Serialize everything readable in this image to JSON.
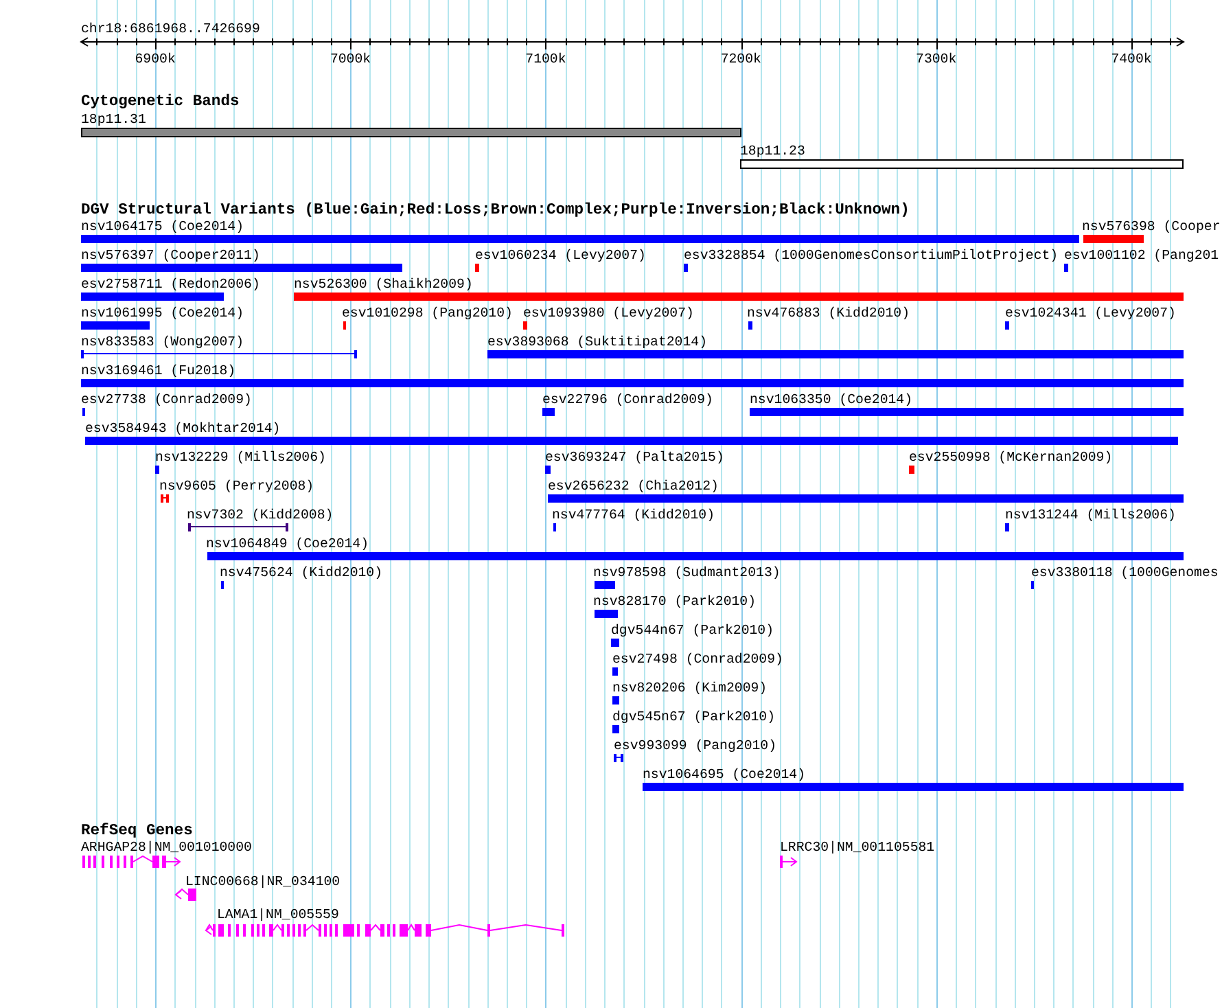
{
  "ruler": {
    "position": "chr18:6861968..7426699",
    "ticks": [
      "6900k",
      "7000k",
      "7100k",
      "7200k",
      "7300k",
      "7400k"
    ]
  },
  "tracks": [
    {
      "kind": "bands",
      "title": "Cytogenetic Bands",
      "bands": [
        {
          "label": "18p11.31",
          "color": "#888888"
        },
        {
          "label": "18p11.23",
          "color": "#ffffff"
        }
      ]
    },
    {
      "kind": "variants",
      "title": "DGV Structural Variants (Blue:Gain;Red:Loss;Brown:Complex;Purple:Inversion;Black:Unknown)",
      "rows": [
        {
          "items": [
            {
              "label": "nsv1064175 (Coe2014)",
              "kind": "bar",
              "color": "#0000ff"
            },
            {
              "label": "nsv576398 (Cooper",
              "kind": "bar",
              "color": "#ff0000"
            }
          ]
        },
        {
          "items": [
            {
              "label": "nsv576397 (Cooper2011)",
              "kind": "bar",
              "color": "#0000ff"
            },
            {
              "label": "esv1060234 (Levy2007)",
              "kind": "bar",
              "color": "#ff0000"
            },
            {
              "label": "esv3328854 (1000GenomesConsortiumPilotProject)",
              "kind": "bar",
              "color": "#0000ff"
            },
            {
              "label": "esv1001102 (Pang201",
              "kind": "bar",
              "color": "#0000ff"
            }
          ]
        },
        {
          "items": [
            {
              "label": "esv2758711 (Redon2006)",
              "kind": "bar",
              "color": "#0000ff"
            },
            {
              "label": "nsv526300 (Shaikh2009)",
              "kind": "bar",
              "color": "#ff0000"
            }
          ]
        },
        {
          "items": [
            {
              "label": "nsv1061995 (Coe2014)",
              "kind": "bar",
              "color": "#0000ff"
            },
            {
              "label": "esv1010298 (Pang2010)",
              "kind": "bar",
              "color": "#ff0000"
            },
            {
              "label": "esv1093980 (Levy2007)",
              "kind": "bar",
              "color": "#ff0000"
            },
            {
              "label": "nsv476883 (Kidd2010)",
              "kind": "bar",
              "color": "#0000ff"
            },
            {
              "label": "esv1024341 (Levy2007)",
              "kind": "bar",
              "color": "#0000ff"
            }
          ]
        },
        {
          "items": [
            {
              "label": "nsv833583 (Wong2007)",
              "kind": "span",
              "color": "#0000ff"
            },
            {
              "label": "esv3893068 (Suktitipat2014)",
              "kind": "bar",
              "color": "#0000ff"
            }
          ]
        },
        {
          "items": [
            {
              "label": "nsv3169461 (Fu2018)",
              "kind": "bar",
              "color": "#0000ff"
            }
          ]
        },
        {
          "items": [
            {
              "label": "esv27738 (Conrad2009)",
              "kind": "bar",
              "color": "#0000ff"
            },
            {
              "label": "esv22796 (Conrad2009)",
              "kind": "bar",
              "color": "#0000ff"
            },
            {
              "label": "nsv1063350 (Coe2014)",
              "kind": "bar",
              "color": "#0000ff"
            }
          ]
        },
        {
          "items": [
            {
              "label": "esv3584943 (Mokhtar2014)",
              "kind": "bar",
              "color": "#0000ff"
            }
          ]
        },
        {
          "items": [
            {
              "label": "nsv132229 (Mills2006)",
              "kind": "bar",
              "color": "#0000ff"
            },
            {
              "label": "esv3693247 (Palta2015)",
              "kind": "bar",
              "color": "#0000ff"
            },
            {
              "label": "esv2550998 (McKernan2009)",
              "kind": "bar",
              "color": "#ff0000"
            }
          ]
        },
        {
          "items": [
            {
              "label": "nsv9605 (Perry2008)",
              "kind": "span",
              "color": "#ff0000"
            },
            {
              "label": "esv2656232 (Chia2012)",
              "kind": "bar",
              "color": "#0000ff"
            }
          ]
        },
        {
          "items": [
            {
              "label": "nsv7302 (Kidd2008)",
              "kind": "span",
              "color": "#400080"
            },
            {
              "label": "nsv477764 (Kidd2010)",
              "kind": "bar",
              "color": "#0000ff"
            },
            {
              "label": "nsv131244 (Mills2006)",
              "kind": "bar",
              "color": "#0000ff"
            }
          ]
        },
        {
          "items": [
            {
              "label": "nsv1064849 (Coe2014)",
              "kind": "bar",
              "color": "#0000ff"
            }
          ]
        },
        {
          "items": [
            {
              "label": "nsv475624 (Kidd2010)",
              "kind": "bar",
              "color": "#0000ff"
            },
            {
              "label": "nsv978598 (Sudmant2013)",
              "kind": "bar",
              "color": "#0000ff"
            },
            {
              "label": "esv3380118 (1000Genomes",
              "kind": "bar",
              "color": "#0000ff"
            }
          ]
        },
        {
          "items": [
            {
              "label": "nsv828170 (Park2010)",
              "kind": "bar",
              "color": "#0000ff"
            }
          ]
        },
        {
          "items": [
            {
              "label": "dgv544n67 (Park2010)",
              "kind": "bar",
              "color": "#0000ff"
            }
          ]
        },
        {
          "items": [
            {
              "label": "esv27498 (Conrad2009)",
              "kind": "bar",
              "color": "#0000ff"
            }
          ]
        },
        {
          "items": [
            {
              "label": "nsv820206 (Kim2009)",
              "kind": "bar",
              "color": "#0000ff"
            }
          ]
        },
        {
          "items": [
            {
              "label": "dgv545n67 (Park2010)",
              "kind": "bar",
              "color": "#0000ff"
            }
          ]
        },
        {
          "items": [
            {
              "label": "esv993099 (Pang2010)",
              "kind": "span",
              "color": "#0000ff"
            }
          ]
        },
        {
          "items": [
            {
              "label": "nsv1064695 (Coe2014)",
              "kind": "bar",
              "color": "#0000ff"
            }
          ]
        }
      ]
    },
    {
      "kind": "genes",
      "title": "RefSeq Genes",
      "genes": [
        {
          "label": "ARHGAP28|NM_001010000",
          "reverse": false
        },
        {
          "label": "LRRC30|NM_001105581",
          "reverse": false
        },
        {
          "label": "LINC00668|NR_034100",
          "reverse": true
        },
        {
          "label": "LAMA1|NM_005559",
          "reverse": true
        }
      ]
    }
  ]
}
